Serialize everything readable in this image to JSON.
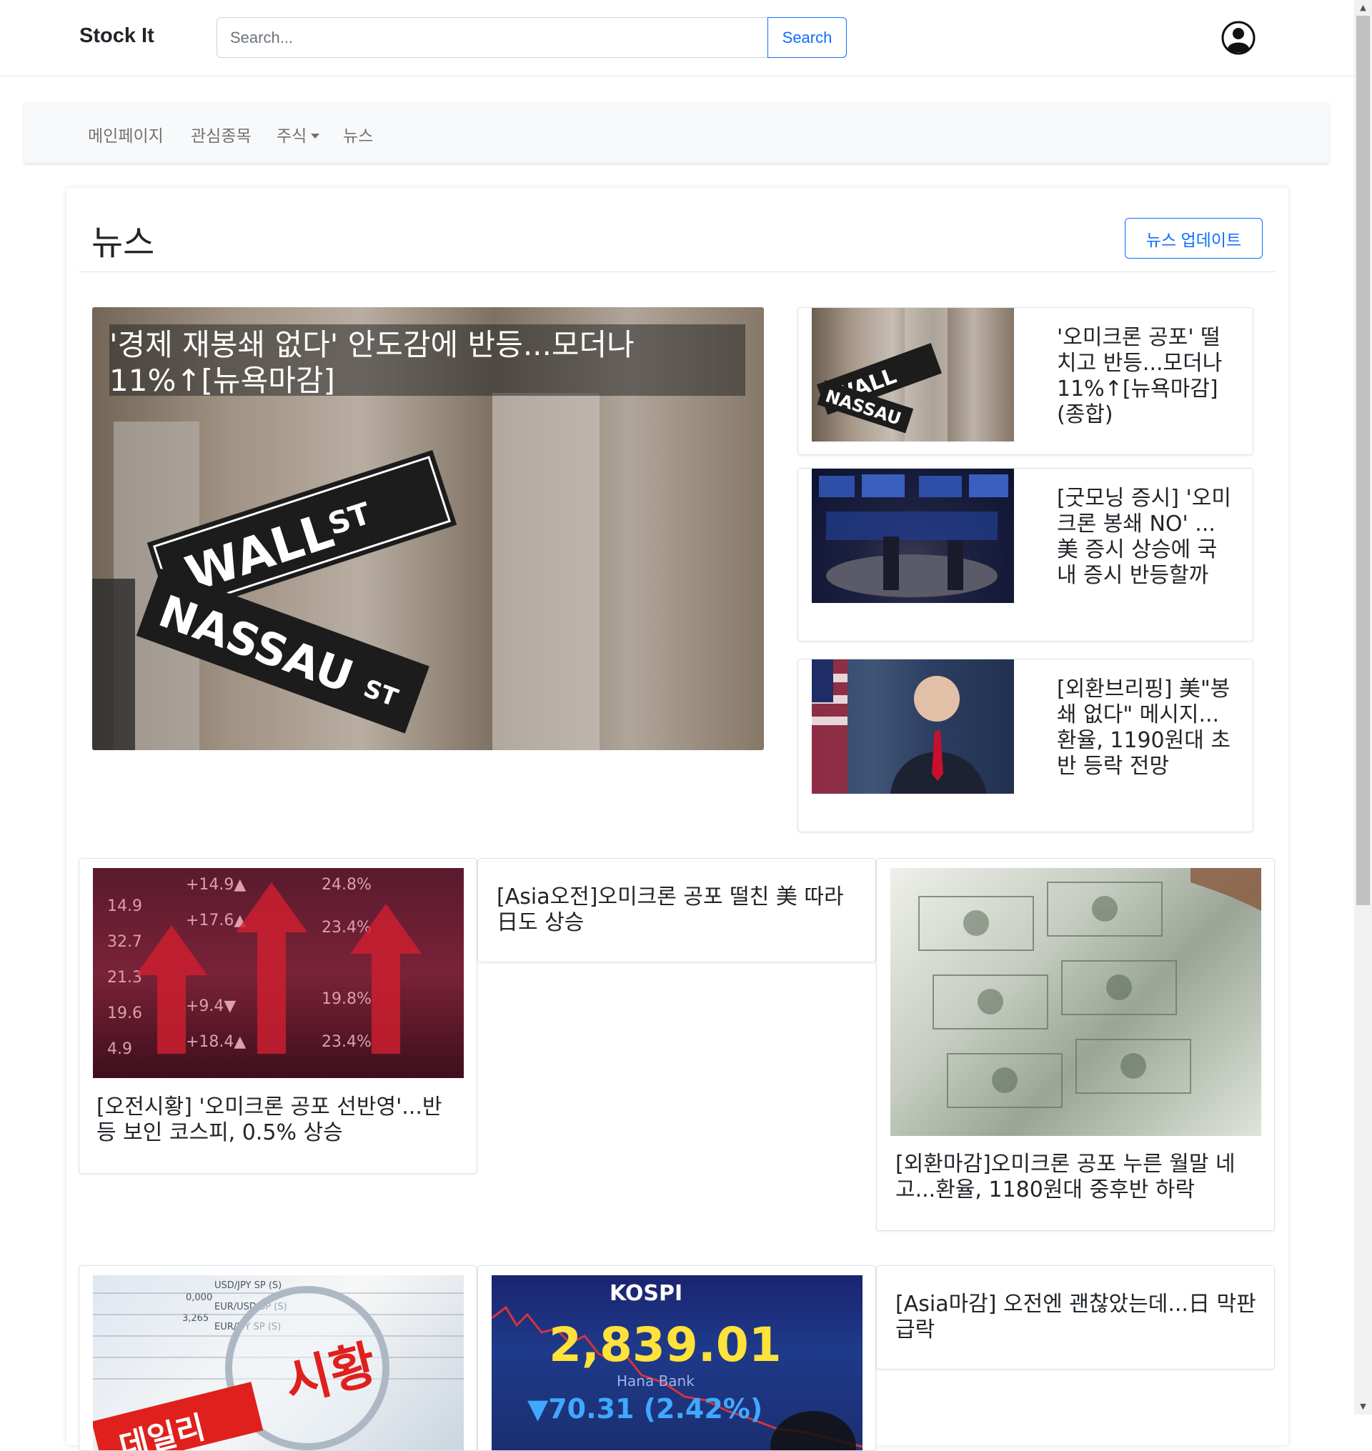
{
  "header": {
    "brand": "Stock It",
    "search_placeholder": "Search...",
    "search_button": "Search"
  },
  "nav": {
    "items": [
      {
        "label": "메인페이지"
      },
      {
        "label": "관심종목"
      },
      {
        "label": "주식"
      },
      {
        "label": "뉴스"
      }
    ]
  },
  "page": {
    "title": "뉴스",
    "update_button": "뉴스 업데이트"
  },
  "news": {
    "hero": {
      "title": "'경제 재봉쇄 없다' 안도감에 반등...모더나 11%↑[뉴욕마감]",
      "image": "wall-street-sign"
    },
    "side": [
      {
        "title": "'오미크론 공포' 떨치고 반등...모더나 11%↑[뉴욕마감](종합)",
        "image": "wall-street-sign"
      },
      {
        "title": "[굿모닝 증시] '오미크론 봉쇄 NO' ...美 증시 상승에 국내 증시 반등할까",
        "image": "nyse-trading-floor"
      },
      {
        "title": "[외환브리핑] 美\"봉쇄 없다\" 메시지...환율, 1190원대 초반 등락 전망",
        "image": "president-speech"
      }
    ],
    "grid": [
      {
        "title": "[오전시황] '오미크론 공포 선반영'...반등 보인 코스피, 0.5% 상승",
        "image": "stock-board-arrows"
      },
      {
        "title": "[Asia오전]오미크론 공포 떨친 美 따라 日도 상승"
      },
      {
        "title": "[외환마감]오미크론 공포 누른 월말 네고...환율, 1180원대 중후반 하락",
        "image": "dollar-bills"
      },
      {
        "image": "fx-market-magnifier",
        "image_text": "시황",
        "image_text_2": "데일리"
      },
      {
        "image": "kospi-board",
        "image_text": "KOSPI",
        "image_value": "2,839.01",
        "image_change": "▼70.31 (2.42%)",
        "image_brand": "Hana Bank"
      },
      {
        "title": "[Asia마감] 오전엔 괜찮았는데...日 막판 급락"
      }
    ]
  }
}
